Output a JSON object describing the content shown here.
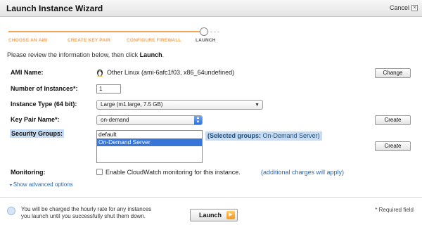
{
  "window": {
    "title": "Launch Instance Wizard",
    "cancel_label": "Cancel",
    "cancel_icon": "close-icon"
  },
  "steps": [
    {
      "label": "CHOOSE AN AMI",
      "state": "done"
    },
    {
      "label": "CREATE KEY PAIR",
      "state": "done"
    },
    {
      "label": "CONFIGURE FIREWALL",
      "state": "done"
    },
    {
      "label": "LAUNCH",
      "state": "current"
    }
  ],
  "intro": {
    "text": "Please review the information below, then click ",
    "bold": "Launch",
    "suffix": "."
  },
  "form": {
    "ami": {
      "label": "AMI Name:",
      "value": "Other Linux (ami-6afc1f03, x86_64undefined)",
      "icon": "linux-penguin-icon",
      "button": "Change"
    },
    "instances": {
      "label": "Number of Instances*:",
      "value": "1"
    },
    "instance_type": {
      "label": "Instance Type (64 bit):",
      "value": "Large (m1.large, 7.5 GB)"
    },
    "key_pair": {
      "label": "Key Pair Name*:",
      "value": "on-demand",
      "button": "Create"
    },
    "security_groups": {
      "label": "Security Groups:",
      "options": [
        "default",
        "On-Demand Server"
      ],
      "selected": "On-Demand Server",
      "selected_prefix": "(Selected groups:",
      "selected_value": " On-Demand Server)",
      "button": "Create"
    },
    "monitoring": {
      "label": "Monitoring:",
      "checkbox_text": "Enable CloudWatch monitoring for this instance.",
      "checked": false,
      "link": "(additional charges will apply)"
    },
    "advanced_link": "Show advanced options"
  },
  "footer": {
    "note": "You will be charged the hourly rate for any instances you launch until you successfully shut them down.",
    "launch_label": "Launch",
    "required_note": "* Required field"
  },
  "colors": {
    "step_accent": "#f0a35a",
    "selection_blue": "#3875d7",
    "highlight_blue": "#c6dbf4",
    "link_blue": "#2c67a8"
  }
}
